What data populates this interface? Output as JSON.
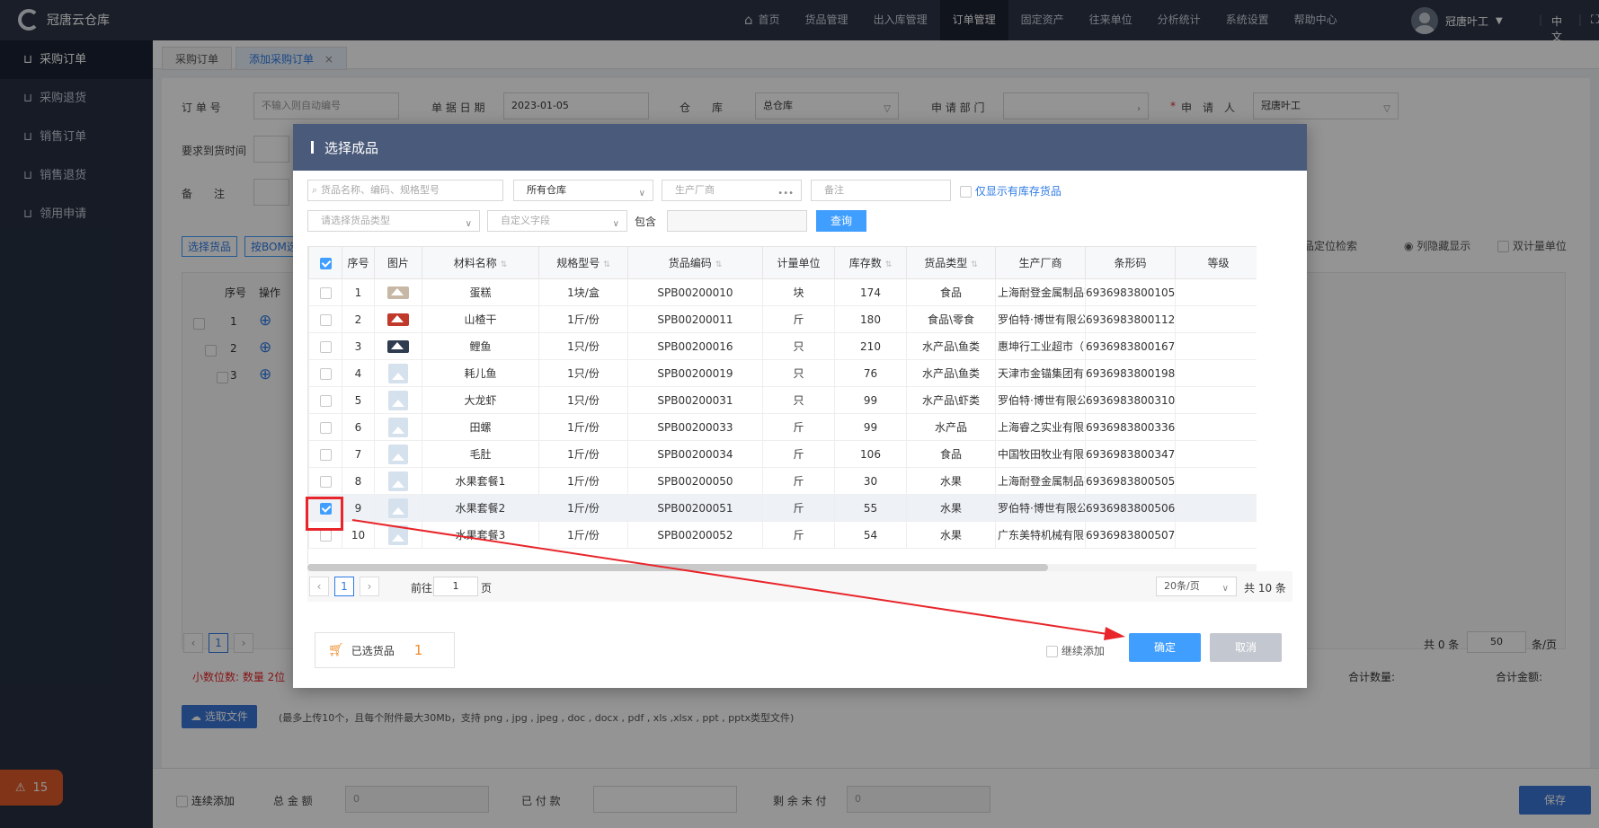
{
  "app": {
    "title": "冠唐云仓库"
  },
  "topnav": [
    {
      "label": "首页",
      "icon": "home-icon"
    },
    {
      "label": "货品管理"
    },
    {
      "label": "出入库管理"
    },
    {
      "label": "订单管理",
      "active": true
    },
    {
      "label": "固定资产"
    },
    {
      "label": "往来单位"
    },
    {
      "label": "分析统计"
    },
    {
      "label": "系统设置"
    },
    {
      "label": "帮助中心"
    }
  ],
  "user": {
    "name": "冠唐叶工",
    "lang": "中文"
  },
  "sidebar": [
    {
      "label": "采购订单",
      "active": true
    },
    {
      "label": "采购退货"
    },
    {
      "label": "销售订单"
    },
    {
      "label": "销售退货"
    },
    {
      "label": "领用申请"
    }
  ],
  "notify_count": "15",
  "tabs": [
    {
      "label": "采购订单"
    },
    {
      "label": "添加采购订单",
      "close": "×"
    }
  ],
  "form": {
    "order_no_label": "订 单 号",
    "order_no_placeholder": "不输入则自动编号",
    "date_label": "单 据 日 期",
    "date_value": "2023-01-05",
    "warehouse_label": "仓　　库",
    "warehouse_value": "总仓库",
    "dept_label": "申 请 部 门",
    "applicant_label": "申　请　人",
    "applicant_star": "*",
    "applicant_value": "冠唐叶工",
    "arrival_label": "要求到货时间",
    "remark_label": "备　　注"
  },
  "bg_tools": {
    "select_goods": "选择货品",
    "by_bom": "按BOM选",
    "locate": "货品定位检索",
    "hide_cols": "列隐藏显示",
    "dual_unit": "双计量单位"
  },
  "bg_table": {
    "headers": [
      "序号",
      "操作"
    ],
    "rows": [
      "1",
      "2",
      "3"
    ],
    "total": "共 0 条",
    "per_page": "50",
    "per_page_unit": "条/页",
    "page": "1"
  },
  "decimal_note": "小数位数: 数量 2位",
  "totals": {
    "qty": "合计数量:",
    "amount": "合计金额:"
  },
  "upload": {
    "button": "选取文件",
    "hint": "(最多上传10个，且每个附件最大30Mb，支持 png , jpg , jpeg , doc , docx , pdf , xls ,xlsx , ppt , pptx类型文件)"
  },
  "footer": {
    "continue": "连续添加",
    "total_label": "总 金 额",
    "total_value": "0",
    "paid_label": "已 付 款",
    "remain_label": "剩 余 未 付",
    "remain_value": "0",
    "save": "保存"
  },
  "dialog": {
    "title": "选择成品",
    "search_placeholder": "货品名称、编码、规格型号",
    "warehouse": "所有仓库",
    "maker_placeholder": "生产厂商",
    "remark_placeholder": "备注",
    "only_stock": "仅显示有库存货品",
    "type_placeholder": "请选择货品类型",
    "custom_field": "自定义字段",
    "contains_label": "包含",
    "query": "查询",
    "columns": [
      "序号",
      "图片",
      "材料名称",
      "规格型号",
      "货品编码",
      "计量单位",
      "库存数",
      "货品类型",
      "生产厂商",
      "条形码",
      "等级"
    ],
    "rows": [
      {
        "no": "1",
        "name": "蛋糕",
        "spec": "1块/盒",
        "code": "SPB00200010",
        "unit": "块",
        "stock": "174",
        "type": "食品",
        "maker": "上海耐登金属制品有",
        "barcode": "6936983800105",
        "img": "real"
      },
      {
        "no": "2",
        "name": "山楂干",
        "spec": "1斤/份",
        "code": "SPB00200011",
        "unit": "斤",
        "stock": "180",
        "type": "食品\\零食",
        "maker": "罗伯特·博世有限公",
        "barcode": "6936983800112",
        "img": "real red"
      },
      {
        "no": "3",
        "name": "鲤鱼",
        "spec": "1只/份",
        "code": "SPB00200016",
        "unit": "只",
        "stock": "210",
        "type": "水产品\\鱼类",
        "maker": "惠坤行工业超市（",
        "barcode": "6936983800167",
        "img": "real dark"
      },
      {
        "no": "4",
        "name": "耗儿鱼",
        "spec": "1只/份",
        "code": "SPB00200019",
        "unit": "只",
        "stock": "76",
        "type": "水产品\\鱼类",
        "maker": "天津市金锚集团有限",
        "barcode": "6936983800198",
        "img": ""
      },
      {
        "no": "5",
        "name": "大龙虾",
        "spec": "1只/份",
        "code": "SPB00200031",
        "unit": "只",
        "stock": "99",
        "type": "水产品\\虾类",
        "maker": "罗伯特·博世有限公",
        "barcode": "6936983800310",
        "img": ""
      },
      {
        "no": "6",
        "name": "田螺",
        "spec": "1斤/份",
        "code": "SPB00200033",
        "unit": "斤",
        "stock": "99",
        "type": "水产品",
        "maker": "上海睿之实业有限公",
        "barcode": "6936983800336",
        "img": ""
      },
      {
        "no": "7",
        "name": "毛肚",
        "spec": "1斤/份",
        "code": "SPB00200034",
        "unit": "斤",
        "stock": "106",
        "type": "食品",
        "maker": "中国牧田牧业有限公",
        "barcode": "6936983800347",
        "img": ""
      },
      {
        "no": "8",
        "name": "水果套餐1",
        "spec": "1斤/份",
        "code": "SPB00200050",
        "unit": "斤",
        "stock": "30",
        "type": "水果",
        "maker": "上海耐登金属制品有",
        "barcode": "6936983800505",
        "img": ""
      },
      {
        "no": "9",
        "name": "水果套餐2",
        "spec": "1斤/份",
        "code": "SPB00200051",
        "unit": "斤",
        "stock": "55",
        "type": "水果",
        "maker": "罗伯特·博世有限公",
        "barcode": "6936983800506",
        "img": "",
        "checked": true
      },
      {
        "no": "10",
        "name": "水果套餐3",
        "spec": "1斤/份",
        "code": "SPB00200052",
        "unit": "斤",
        "stock": "54",
        "type": "水果",
        "maker": "广东美特机械有限公",
        "barcode": "6936983800507",
        "img": ""
      }
    ],
    "pager": {
      "page": "1",
      "goto_prefix": "前往",
      "goto_value": "1",
      "goto_suffix": "页",
      "page_size": "20条/页",
      "total": "共 10 条"
    },
    "selected_label": "已选货品",
    "selected_count": "1",
    "continue_add": "继续添加",
    "confirm": "确定",
    "cancel": "取消"
  },
  "colors": {
    "accent": "#409eff",
    "header": "#2b3446",
    "annotation": "#e8252a"
  }
}
